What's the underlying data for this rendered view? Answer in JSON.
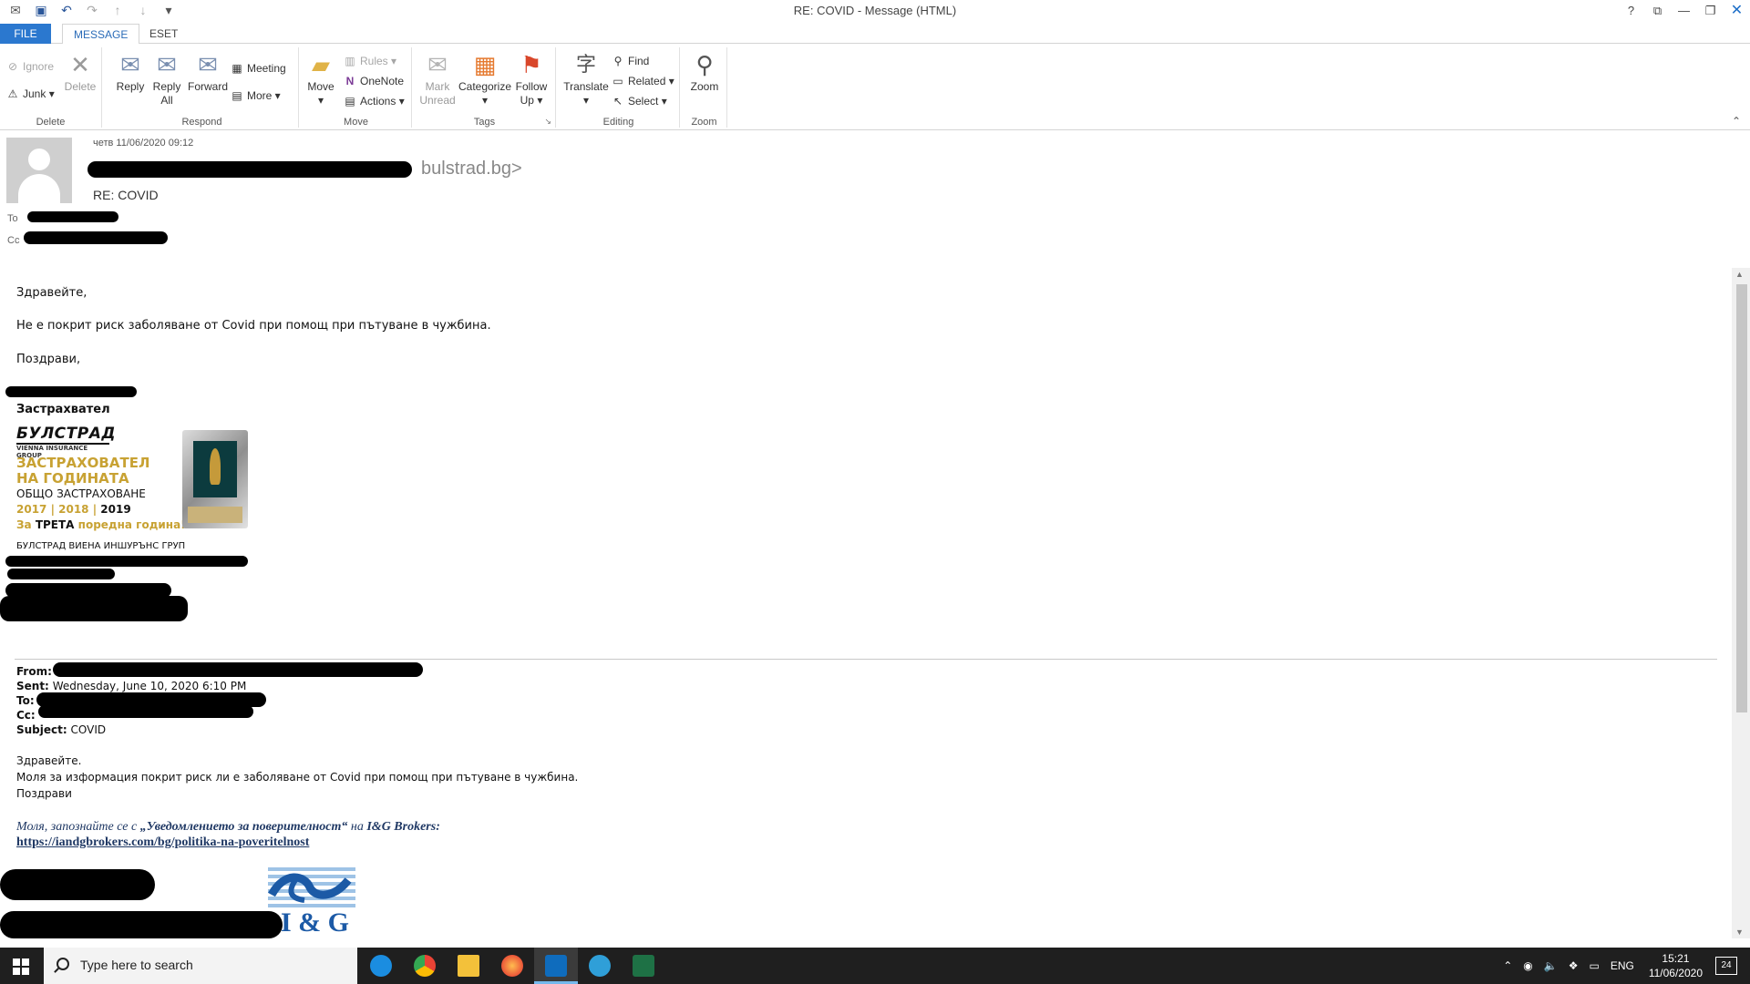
{
  "window": {
    "title": "RE: COVID - Message (HTML)",
    "controls": [
      "?",
      "⧉",
      "—",
      "❐",
      "✕"
    ]
  },
  "tabs": [
    {
      "label": "FILE"
    },
    {
      "label": "MESSAGE"
    },
    {
      "label": "ESET"
    }
  ],
  "ribbon": {
    "delete_group": {
      "label": "Delete",
      "ignore": "Ignore",
      "junk": "Junk",
      "delete": "Delete"
    },
    "respond_group": {
      "label": "Respond",
      "reply": "Reply",
      "reply_all_1": "Reply",
      "reply_all_2": "All",
      "forward": "Forward",
      "meeting": "Meeting",
      "more": "More"
    },
    "move_group": {
      "label": "Move",
      "move": "Move",
      "rules": "Rules",
      "onenote": "OneNote",
      "actions": "Actions"
    },
    "tags_group": {
      "label": "Tags",
      "mark_unread_1": "Mark",
      "mark_unread_2": "Unread",
      "categorize": "Categorize",
      "follow_up_1": "Follow",
      "follow_up_2": "Up"
    },
    "editing_group": {
      "label": "Editing",
      "translate": "Translate",
      "find": "Find",
      "related": "Related",
      "select": "Select"
    },
    "zoom_group": {
      "label": "Zoom",
      "zoom": "Zoom"
    }
  },
  "header": {
    "date": "четв 11/06/2020 09:12",
    "sender_visible": "bulstrad.bg>",
    "subject": "RE: COVID",
    "to_label": "To",
    "cc_label": "Cc"
  },
  "body": {
    "greeting": "Здравейте,",
    "line1": "Не е покрит риск заболяване от Covid при помощ при пътуване в чужбина.",
    "regards": "Поздрави,",
    "sig_title": "Застрахвател",
    "logo_name": "БУЛСТРАД",
    "logo_group": "VIENNA INSURANCE GROUP",
    "award_1": "ЗАСТРАХОВАТЕЛ",
    "award_2": "НА ГОДИНАТА",
    "award_3": "ОБЩО ЗАСТРАХОВАНЕ",
    "award_years": "2017 | 2018 |",
    "award_year_last": "2019",
    "award_third_pre": "За",
    "award_third_bold": "ТРЕТА",
    "award_third_post": "поредна година!",
    "company": "БУЛСТРАД ВИЕНА ИНШУРЪНС ГРУП"
  },
  "quoted": {
    "from_label": "From:",
    "sent_label": "Sent:",
    "sent_value": "Wednesday, June 10, 2020 6:10 PM",
    "to_label": "To:",
    "cc_label": "Cc:",
    "subject_label": "Subject:",
    "subject_value": "COVID",
    "greeting": "Здравейте.",
    "line1": "Моля за изформация покрит риск ли е заболяване от Covid при помощ при пътуване в чужбина.",
    "regards": "Поздрави",
    "notice_pre": "Моля, запознайте се с",
    "notice_bold": "„Уведомлението за поверителност“",
    "notice_mid": "на",
    "notice_brand": "I&G Brokers:",
    "link": "https://iandgbrokers.com/bg/politika-na-poveritelnost",
    "logo_text": "I & G"
  },
  "taskbar": {
    "search_placeholder": "Type here to search",
    "language": "ENG",
    "time": "15:21",
    "date": "11/06/2020",
    "notifications": "24"
  },
  "colors": {
    "file_tab": "#2b78cf",
    "accent": "#2b6cb8",
    "gold": "#c8a233",
    "notice_blue": "#1f3864",
    "taskbar": "#1f1f1f"
  }
}
